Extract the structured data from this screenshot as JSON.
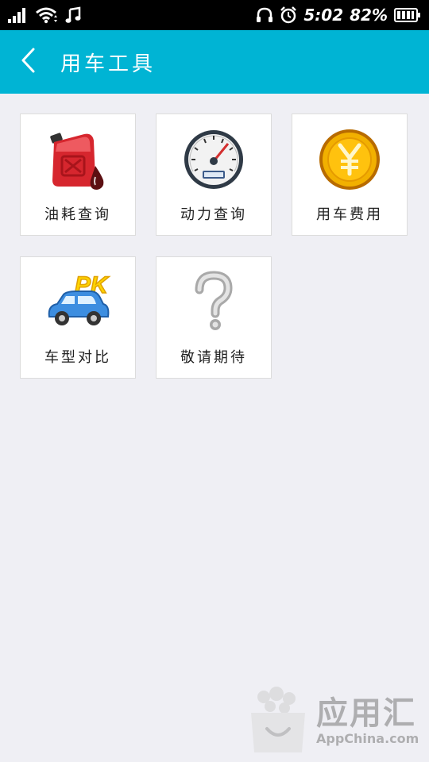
{
  "status_bar": {
    "time": "5:02",
    "battery_percent": "82%",
    "icons": [
      "signal-icon",
      "wifi-icon",
      "music-note-icon",
      "headphones-icon",
      "alarm-clock-icon",
      "battery-icon"
    ]
  },
  "header": {
    "back_icon": "chevron-left-icon",
    "title": "用车工具",
    "background_color": "#00b4d4"
  },
  "tools": [
    {
      "label": "油耗查询",
      "icon": "fuel-can-icon"
    },
    {
      "label": "动力查询",
      "icon": "speedometer-icon"
    },
    {
      "label": "用车费用",
      "icon": "yuan-coin-icon"
    },
    {
      "label": "车型对比",
      "icon": "car-pk-icon"
    },
    {
      "label": "敬请期待",
      "icon": "question-mark-icon"
    }
  ],
  "watermark": {
    "name": "应用汇",
    "domain": "AppChina.com"
  }
}
